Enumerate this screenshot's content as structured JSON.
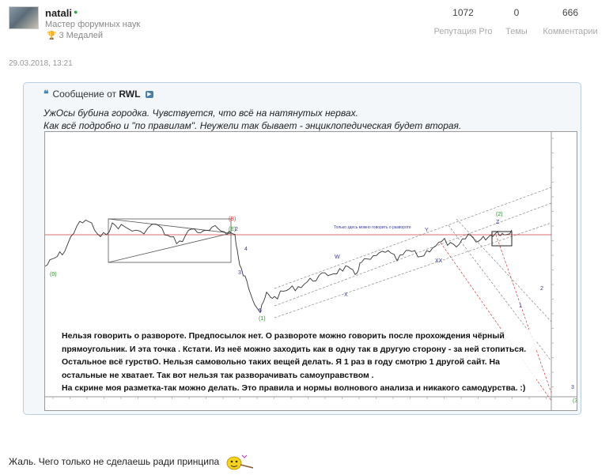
{
  "user": {
    "name": "natali",
    "rank": "Мастер форумных наук",
    "medals": "3 Медалей"
  },
  "stats": [
    {
      "value": "1072",
      "label": "Репутация Pro"
    },
    {
      "value": "0",
      "label": "Темы"
    },
    {
      "value": "666",
      "label": "Комментарии"
    }
  ],
  "post": {
    "date": "29.03.2018, 13:21",
    "quote": {
      "label": "Сообщение от",
      "author": "RWL",
      "line1": "УжОсы бубина городка. Чувствуется, что всё на натянутых нервах.",
      "line2": "Как всё подробно и \"по правилам\". Неужели так бывает - энциклопедическая будет вторая."
    },
    "chart_annotation": [
      "Нельзя говорить о развороте. Предпосылок нет. О развороте можно говорить после прохождения чёрный",
      "прямоугольник. И эта точка . Кстати. Из неё можно заходить как в одну так в другую сторону - за ней стопиться.",
      "Остальное всё гурствО. Нельзя самовольно таких вещей делать. Я 1 раз в году смотрю 1 другой сайт. На",
      "остальные не хватает. Так вот нельзя так разворачивать самоуправством .",
      "На скрине моя разметка-так можно делать. Это правила и нормы волнового анализа и никакого самодурства. :)"
    ],
    "chart_note": "Только здесь можно говорить о развороте",
    "footer_text": "Жаль. Чего только не сделаешь ради принципа"
  },
  "chart_data": {
    "type": "line",
    "title": "",
    "wave_labels": [
      "(0)",
      "(E)",
      "2",
      "(B)",
      "3",
      "4",
      "5",
      "(1)",
      "W",
      "X",
      "Y",
      "XX",
      "Z",
      "(2)",
      "1",
      "2",
      "3",
      "(3)"
    ],
    "colors": {
      "price": "#333333",
      "channel": "#8e8eb0",
      "red": "#d33c3c",
      "green": "#2e8b2e",
      "blue": "#3a3aa8"
    }
  }
}
